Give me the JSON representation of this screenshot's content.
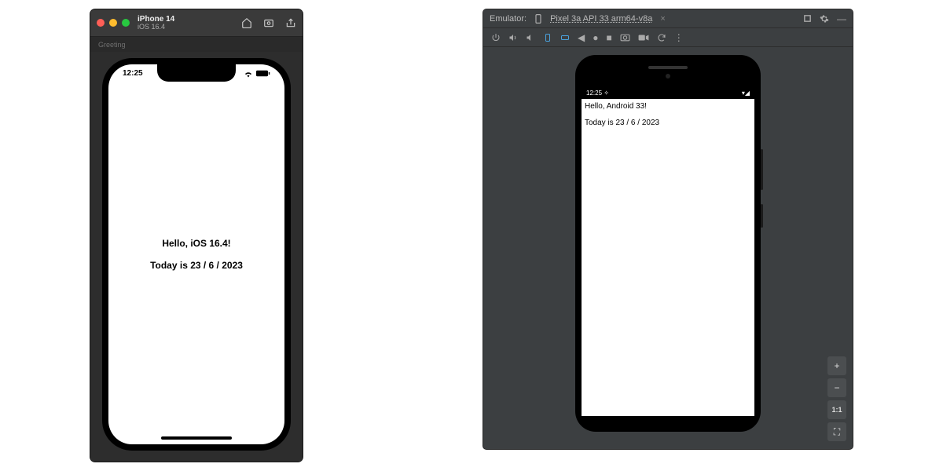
{
  "ios": {
    "window": {
      "title": "iPhone 14",
      "subtitle": "iOS 16.4",
      "tabs": [
        "Greeting"
      ]
    },
    "status": {
      "time": "12:25"
    },
    "screen": {
      "greeting": "Hello, iOS 16.4!",
      "date_line": "Today is 23 / 6 / 2023"
    }
  },
  "android": {
    "window": {
      "label": "Emulator:",
      "device": "Pixel 3a API 33 arm64-v8a"
    },
    "status": {
      "time": "12:25"
    },
    "screen": {
      "greeting": "Hello, Android 33!",
      "date_line": "Today is 23 / 6 / 2023"
    },
    "zoom": {
      "plus": "+",
      "minus": "−",
      "fit": "1:1",
      "expand": "⛶"
    }
  }
}
